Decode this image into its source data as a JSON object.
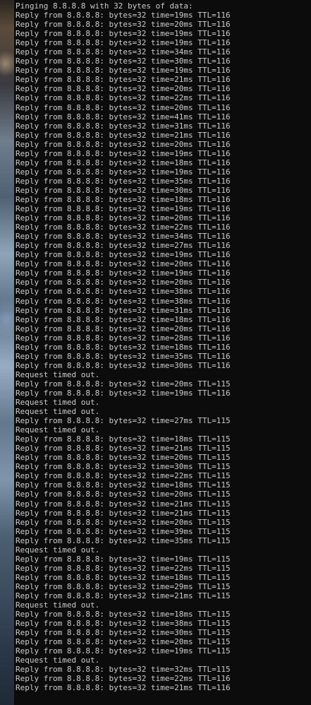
{
  "terminal": {
    "lines": [
      "Pinging 8.8.8.8 with 32 bytes of data:",
      "Reply from 8.8.8.8: bytes=32 time=19ms TTL=116",
      "Reply from 8.8.8.8: bytes=32 time=20ms TTL=116",
      "Reply from 8.8.8.8: bytes=32 time=19ms TTL=116",
      "Reply from 8.8.8.8: bytes=32 time=19ms TTL=116",
      "Reply from 8.8.8.8: bytes=32 time=34ms TTL=116",
      "Reply from 8.8.8.8: bytes=32 time=30ms TTL=116",
      "Reply from 8.8.8.8: bytes=32 time=19ms TTL=116",
      "Reply from 8.8.8.8: bytes=32 time=21ms TTL=116",
      "Reply from 8.8.8.8: bytes=32 time=20ms TTL=116",
      "Reply from 8.8.8.8: bytes=32 time=22ms TTL=116",
      "Reply from 8.8.8.8: bytes=32 time=20ms TTL=116",
      "Reply from 8.8.8.8: bytes=32 time=41ms TTL=116",
      "Reply from 8.8.8.8: bytes=32 time=31ms TTL=116",
      "Reply from 8.8.8.8: bytes=32 time=21ms TTL=116",
      "Reply from 8.8.8.8: bytes=32 time=20ms TTL=116",
      "Reply from 8.8.8.8: bytes=32 time=19ms TTL=116",
      "Reply from 8.8.8.8: bytes=32 time=18ms TTL=116",
      "Reply from 8.8.8.8: bytes=32 time=19ms TTL=116",
      "Reply from 8.8.8.8: bytes=32 time=35ms TTL=116",
      "Reply from 8.8.8.8: bytes=32 time=30ms TTL=116",
      "Reply from 8.8.8.8: bytes=32 time=18ms TTL=116",
      "Reply from 8.8.8.8: bytes=32 time=19ms TTL=116",
      "Reply from 8.8.8.8: bytes=32 time=20ms TTL=116",
      "Reply from 8.8.8.8: bytes=32 time=22ms TTL=116",
      "Reply from 8.8.8.8: bytes=32 time=34ms TTL=116",
      "Reply from 8.8.8.8: bytes=32 time=27ms TTL=116",
      "Reply from 8.8.8.8: bytes=32 time=19ms TTL=116",
      "Reply from 8.8.8.8: bytes=32 time=20ms TTL=116",
      "Reply from 8.8.8.8: bytes=32 time=19ms TTL=116",
      "Reply from 8.8.8.8: bytes=32 time=20ms TTL=116",
      "Reply from 8.8.8.8: bytes=32 time=38ms TTL=116",
      "Reply from 8.8.8.8: bytes=32 time=38ms TTL=116",
      "Reply from 8.8.8.8: bytes=32 time=31ms TTL=116",
      "Reply from 8.8.8.8: bytes=32 time=18ms TTL=116",
      "Reply from 8.8.8.8: bytes=32 time=20ms TTL=116",
      "Reply from 8.8.8.8: bytes=32 time=28ms TTL=116",
      "Reply from 8.8.8.8: bytes=32 time=18ms TTL=116",
      "Reply from 8.8.8.8: bytes=32 time=35ms TTL=116",
      "Reply from 8.8.8.8: bytes=32 time=30ms TTL=116",
      "Request timed out.",
      "Reply from 8.8.8.8: bytes=32 time=20ms TTL=115",
      "Reply from 8.8.8.8: bytes=32 time=19ms TTL=116",
      "Request timed out.",
      "Request timed out.",
      "Reply from 8.8.8.8: bytes=32 time=27ms TTL=115",
      "Request timed out.",
      "Reply from 8.8.8.8: bytes=32 time=18ms TTL=115",
      "Reply from 8.8.8.8: bytes=32 time=21ms TTL=115",
      "Reply from 8.8.8.8: bytes=32 time=20ms TTL=115",
      "Reply from 8.8.8.8: bytes=32 time=30ms TTL=115",
      "Reply from 8.8.8.8: bytes=32 time=22ms TTL=115",
      "Reply from 8.8.8.8: bytes=32 time=18ms TTL=115",
      "Reply from 8.8.8.8: bytes=32 time=20ms TTL=115",
      "Reply from 8.8.8.8: bytes=32 time=21ms TTL=115",
      "Reply from 8.8.8.8: bytes=32 time=21ms TTL=115",
      "Reply from 8.8.8.8: bytes=32 time=20ms TTL=115",
      "Reply from 8.8.8.8: bytes=32 time=39ms TTL=115",
      "Reply from 8.8.8.8: bytes=32 time=35ms TTL=115",
      "Request timed out.",
      "Reply from 8.8.8.8: bytes=32 time=19ms TTL=115",
      "Reply from 8.8.8.8: bytes=32 time=22ms TTL=115",
      "Reply from 8.8.8.8: bytes=32 time=18ms TTL=115",
      "Reply from 8.8.8.8: bytes=32 time=29ms TTL=115",
      "Reply from 8.8.8.8: bytes=32 time=21ms TTL=115",
      "Request timed out.",
      "Reply from 8.8.8.8: bytes=32 time=18ms TTL=115",
      "Reply from 8.8.8.8: bytes=32 time=38ms TTL=115",
      "Reply from 8.8.8.8: bytes=32 time=30ms TTL=115",
      "Reply from 8.8.8.8: bytes=32 time=20ms TTL=115",
      "Reply from 8.8.8.8: bytes=32 time=19ms TTL=115",
      "Request timed out.",
      "Reply from 8.8.8.8: bytes=32 time=32ms TTL=115",
      "Reply from 8.8.8.8: bytes=32 time=22ms TTL=116",
      "Reply from 8.8.8.8: bytes=32 time=21ms TTL=116"
    ]
  },
  "colors": {
    "background": "#0c0c0c",
    "text": "#cccccc"
  }
}
